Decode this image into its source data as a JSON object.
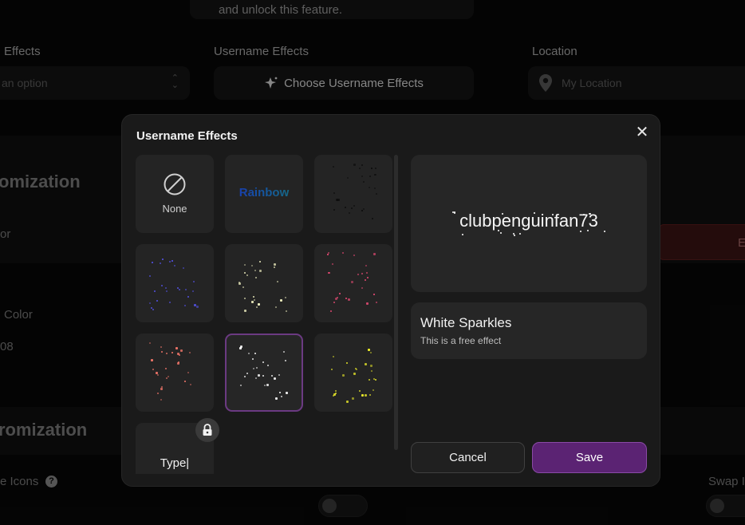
{
  "background": {
    "top_card_text": "and unlock this feature.",
    "labels": {
      "effects": "Effects",
      "username_effects": "Username Effects",
      "location": "Location"
    },
    "select_placeholder": "an option",
    "choose_effects_label": "Choose Username Effects",
    "location_placeholder": "My Location",
    "section1_title": "omization",
    "row_or": "or",
    "row_color": "Color",
    "row_value": "08",
    "red_button_label": "E",
    "section2_title": "romization",
    "icons_label": "e Icons",
    "swap_label": "Swap I"
  },
  "modal": {
    "title": "Username Effects",
    "tiles": {
      "none": "None",
      "rainbow": "Rainbow",
      "type": "Type|"
    },
    "preview": {
      "username": "clubpenguinfan73"
    },
    "selected_effect": {
      "name": "White Sparkles",
      "description": "This is a free effect"
    },
    "cancel_label": "Cancel",
    "save_label": "Save"
  },
  "colors": {
    "accent": "#5b2373",
    "accent_border": "#8a49a6",
    "selected_tile_border": "#6b3a82",
    "blue_sparkles": "#5a58ff",
    "white_sparkles": "#ffffff",
    "pink_sparkles": "#ff4f7e",
    "salmon_sparkles": "#ff7b6e",
    "yellow_sparkles": "#f5f52a"
  }
}
